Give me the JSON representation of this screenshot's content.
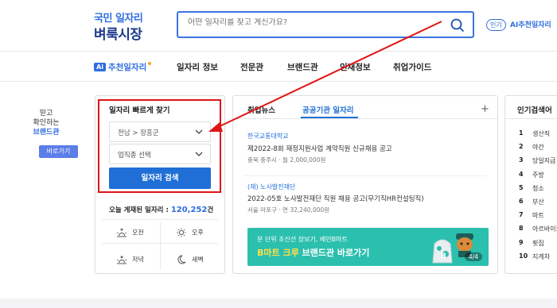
{
  "header": {
    "logo_top": "국민 일자리",
    "logo_bottom": "벼룩시장",
    "search_placeholder": "어떤 일자리를 찾고 계신가요?",
    "search_icon": "search-icon",
    "ai_badge": "인기",
    "ai_link": "AI추천일자리"
  },
  "gnb": {
    "items": [
      {
        "label": "추천일자리",
        "ai": "Ai"
      },
      {
        "label": "일자리 정보"
      },
      {
        "label": "전문관"
      },
      {
        "label": "브랜드관"
      },
      {
        "label": "인재정보"
      },
      {
        "label": "취업가이드"
      }
    ]
  },
  "brand_banner": {
    "line1": "믿고",
    "line2": "확인하는",
    "line3": "브랜드관",
    "button": "바로가기"
  },
  "quick_search": {
    "title": "일자리 빠르게 찾기",
    "region_value": "전남 > 장흥군",
    "job_placeholder": "업직종 선택",
    "button": "일자리 검색",
    "today_label": "오늘 게재된 일자리 :",
    "today_count": "120,252",
    "today_unit": "건",
    "times": [
      {
        "label": "오전",
        "icon": "sunrise-icon"
      },
      {
        "label": "오후",
        "icon": "sun-icon"
      },
      {
        "label": "저녁",
        "icon": "sunset-icon"
      },
      {
        "label": "새벽",
        "icon": "moon-icon"
      }
    ]
  },
  "news": {
    "tab1": "취업뉴스",
    "tab2": "공공기관 일자리",
    "plus": "+",
    "items": [
      {
        "org": "한국교통대학교",
        "title": "제2022-8회 재정지원사업 계약직원 신규채용 공고",
        "meta": "충북 충주시 · 월 2,000,000원"
      },
      {
        "org": "(재) 노사발전재단",
        "title": "2022-05호 노사발전재단 직원 채용 공고(무기직HR컨설팅직)",
        "meta": "서울 마포구 · 연 32,240,000원"
      }
    ],
    "banner": {
      "sub": "분 단위 초신선 장보기, 배민B마트",
      "main_highlight": "B마트 크루",
      "main_rest": " 브랜드관 바로가기",
      "page": "4/4"
    }
  },
  "popular": {
    "title": "인기검색어",
    "items": [
      {
        "rank": "1",
        "term": "생산직"
      },
      {
        "rank": "2",
        "term": "야간"
      },
      {
        "rank": "3",
        "term": "당일지급"
      },
      {
        "rank": "4",
        "term": "주방"
      },
      {
        "rank": "5",
        "term": "청소"
      },
      {
        "rank": "6",
        "term": "부산"
      },
      {
        "rank": "7",
        "term": "마트"
      },
      {
        "rank": "8",
        "term": "아르바이트"
      },
      {
        "rank": "9",
        "term": "횟집"
      },
      {
        "rank": "10",
        "term": "지게차"
      }
    ]
  },
  "colors": {
    "brand_blue": "#1f6fd6",
    "annotation_red": "#e01414",
    "banner_teal": "#2bbfae"
  }
}
